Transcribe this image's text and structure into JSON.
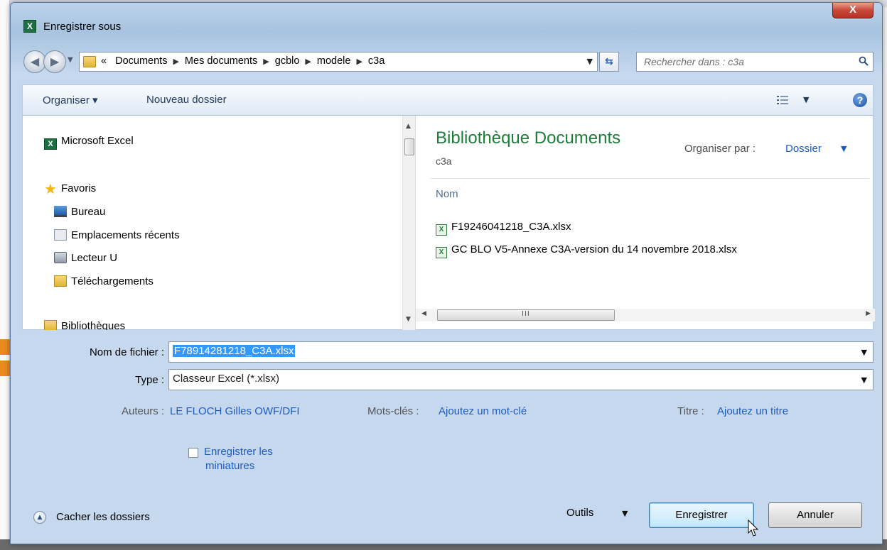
{
  "dialog": {
    "title": "Enregistrer sous",
    "close_label": "X",
    "app_icon_label": "X"
  },
  "address": {
    "prefix": "«",
    "crumbs": [
      "Documents",
      "Mes documents",
      "gcblo",
      "modele",
      "c3a"
    ],
    "search_placeholder": "Rechercher dans : c3a"
  },
  "toolbar": {
    "organise_label": "Organiser ▾",
    "new_folder_label": "Nouveau dossier",
    "help_label": "?"
  },
  "nav_pane": {
    "items": [
      {
        "label": "Microsoft Excel",
        "icon": "excel-icon"
      },
      {
        "label": "Favoris",
        "icon": "star-icon"
      },
      {
        "label": "Bureau",
        "icon": "desktop-icon"
      },
      {
        "label": "Emplacements récents",
        "icon": "recent-places-icon"
      },
      {
        "label": "Lecteur U",
        "icon": "network-drive-icon"
      },
      {
        "label": "Téléchargements",
        "icon": "downloads-folder-icon"
      },
      {
        "label": "Bibliothèques",
        "icon": "libraries-icon"
      }
    ]
  },
  "content": {
    "library_title": "Bibliothèque Documents",
    "library_subtitle": "c3a",
    "arrange_label": "Organiser par :",
    "arrange_value": "Dossier",
    "column_header": "Nom",
    "files": [
      {
        "name": "F19246041218_C3A.xlsx"
      },
      {
        "name": "GC BLO V5-Annexe C3A-version du 14 novembre 2018.xlsx"
      }
    ],
    "scroll_grip": "III"
  },
  "form": {
    "filename_label": "Nom de fichier :",
    "filename_value": "F78914281218_C3A.xlsx",
    "type_label": "Type :",
    "type_value": "Classeur Excel (*.xlsx)",
    "authors_label": "Auteurs :",
    "authors_value": "LE FLOCH Gilles OWF/DFI",
    "keywords_label": "Mots-clés :",
    "keywords_value": "Ajoutez un mot-clé",
    "title_label": "Titre :",
    "title_value": "Ajoutez un titre",
    "thumbnails_line1": "Enregistrer les",
    "thumbnails_line2": "miniatures",
    "thumbnails_checked": false
  },
  "footer": {
    "hide_folders_label": "Cacher les dossiers",
    "tools_label": "Outils",
    "save_label": "Enregistrer",
    "cancel_label": "Annuler"
  },
  "colors": {
    "library_title": "#1e7d3a",
    "link": "#1d5bbf",
    "selection": "#3399ff"
  }
}
